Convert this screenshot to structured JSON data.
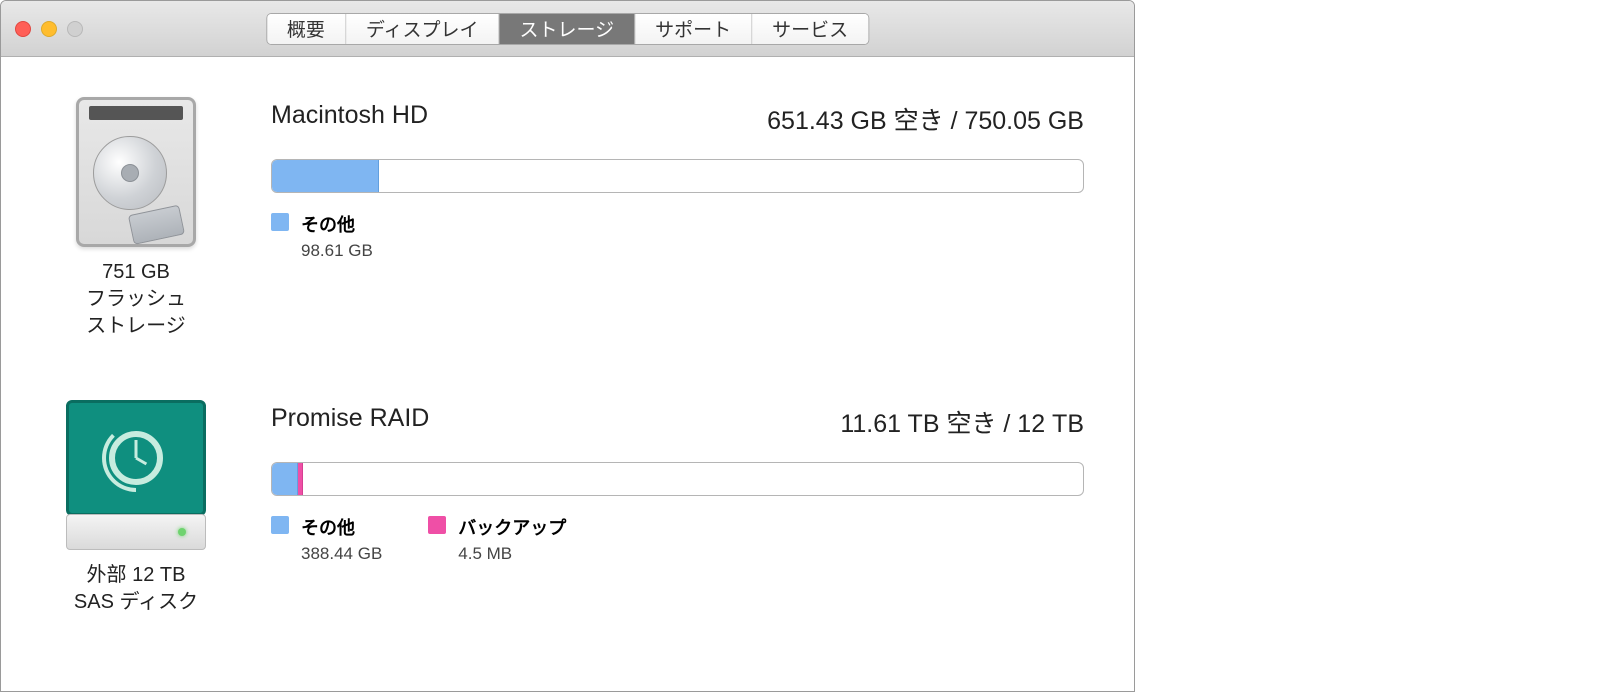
{
  "tabs": [
    {
      "label": "概要",
      "active": false
    },
    {
      "label": "ディスプレイ",
      "active": false
    },
    {
      "label": "ストレージ",
      "active": true
    },
    {
      "label": "サポート",
      "active": false
    },
    {
      "label": "サービス",
      "active": false
    }
  ],
  "drives": [
    {
      "icon": "internal-hdd",
      "icon_label_line1": "751 GB",
      "icon_label_line2": "フラッシュ",
      "icon_label_line3": "ストレージ",
      "title": "Macintosh HD",
      "capacity_text": "651.43 GB 空き / 750.05 GB",
      "bar_segments": [
        {
          "color": "blue",
          "percent": 13.2
        }
      ],
      "legend": [
        {
          "color": "blue",
          "name": "その他",
          "value": "98.61 GB"
        }
      ]
    },
    {
      "icon": "timemachine-ext",
      "icon_label_line1": "外部 12 TB",
      "icon_label_line2": "SAS ディスク",
      "icon_label_line3": "",
      "title": "Promise RAID",
      "capacity_text": "11.61 TB 空き / 12 TB",
      "bar_segments": [
        {
          "color": "blue",
          "percent": 3.2
        },
        {
          "color": "pink",
          "percent": 0.6
        }
      ],
      "legend": [
        {
          "color": "blue",
          "name": "その他",
          "value": "388.44 GB"
        },
        {
          "color": "pink",
          "name": "バックアップ",
          "value": "4.5 MB"
        }
      ]
    }
  ]
}
